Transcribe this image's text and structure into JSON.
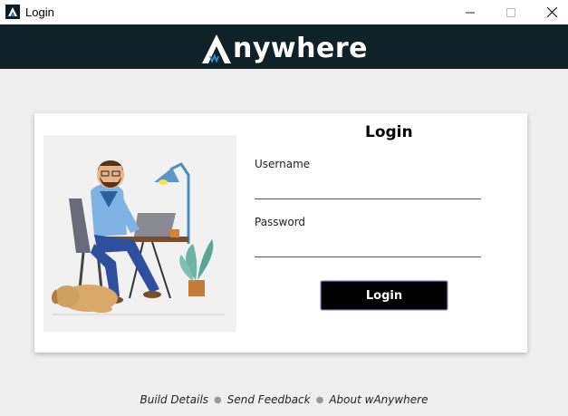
{
  "window": {
    "title": "Login",
    "minimize_icon": "minimize-icon",
    "maximize_icon": "maximize-icon",
    "close_icon": "close-icon"
  },
  "brand": {
    "name_suffix": "nywhere",
    "logo_icon": "anywhere-logo-icon"
  },
  "login": {
    "heading": "Login",
    "username_label": "Username",
    "username_value": "",
    "password_label": "Password",
    "password_value": "",
    "submit_label": "Login"
  },
  "footer": {
    "links": [
      "Build Details",
      "Send Feedback",
      "About wAnywhere"
    ]
  },
  "colors": {
    "brand_bar": "#0f2228",
    "accent_blue": "#3c8fd6",
    "button": "#000000"
  }
}
